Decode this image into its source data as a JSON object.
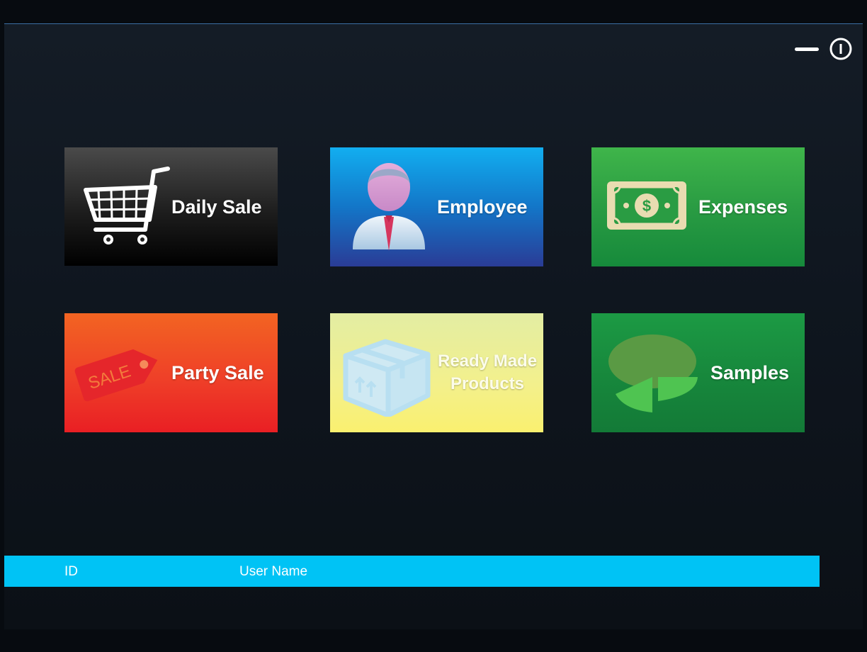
{
  "window": {
    "controls": {
      "minimize_icon": "minimize-icon",
      "power_icon": "power-icon"
    }
  },
  "tiles": [
    {
      "label": "Daily Sale",
      "icon": "shopping-cart-icon",
      "color": "#000000"
    },
    {
      "label": "Employee",
      "icon": "employee-icon",
      "color": "#1376c8"
    },
    {
      "label": "Expenses",
      "icon": "money-icon",
      "color": "#2a9c43"
    },
    {
      "label": "Party Sale",
      "icon": "sale-tag-icon",
      "color": "#ef4028",
      "icon_text": "SALE"
    },
    {
      "label_line1": "Ready Made",
      "label_line2": "Products",
      "icon": "box-icon",
      "color": "#f3f08c"
    },
    {
      "label": "Samples",
      "icon": "pie-chart-icon",
      "color": "#17873c"
    }
  ],
  "grid": {
    "columns": [
      "ID",
      "User Name"
    ],
    "header_color": "#00c3f5"
  }
}
